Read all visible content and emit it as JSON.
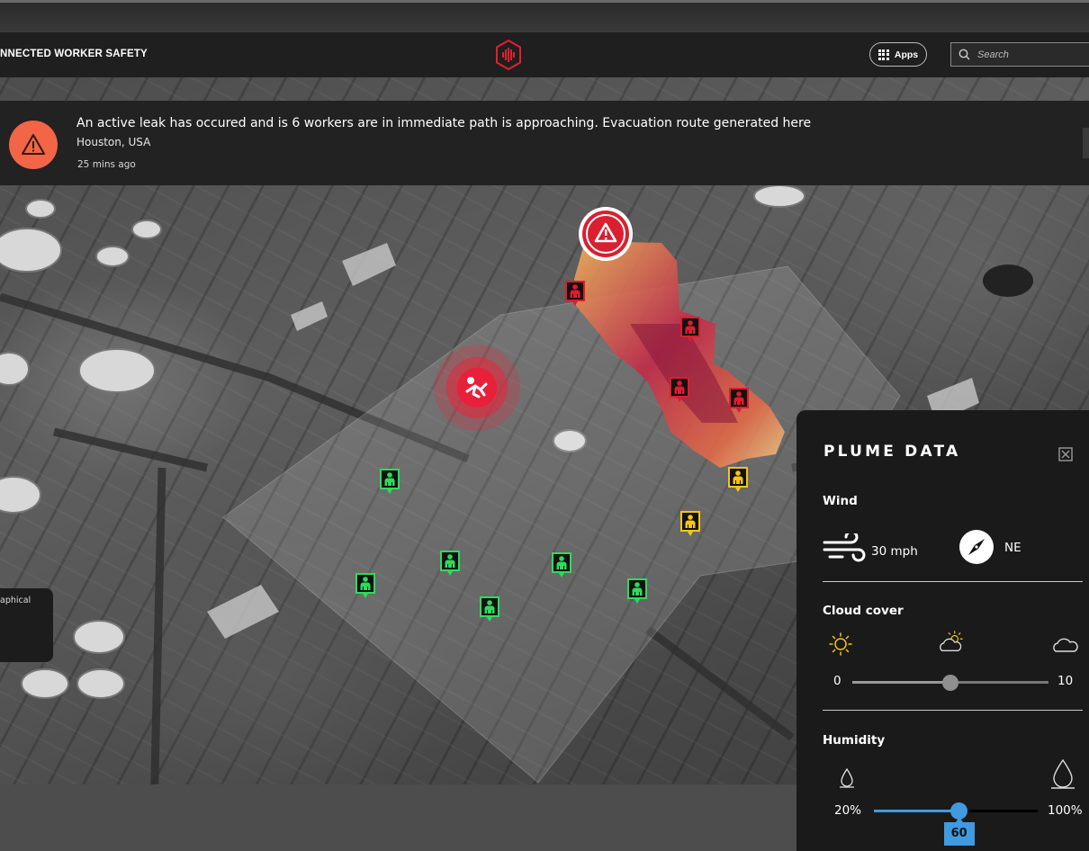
{
  "header": {
    "app_title": "NNECTED WORKER SAFETY",
    "apps_label": "Apps",
    "search_placeholder": "Search"
  },
  "alert": {
    "message": "An active leak has occured and is 6 workers are in immediate path is approaching. Evacuation route generated here",
    "location": "Houston, USA",
    "time": "25 mins ago",
    "color": "#f26546"
  },
  "left_card": {
    "text": "aphical"
  },
  "map": {
    "worker_status_colors": {
      "at_risk": "#e01b2f",
      "warning": "#f5c518",
      "safe": "#2ddc5a"
    },
    "workers": [
      {
        "status": "at_risk",
        "icon": "worker-icon"
      },
      {
        "status": "at_risk",
        "icon": "worker-icon"
      },
      {
        "status": "at_risk",
        "icon": "worker-icon"
      },
      {
        "status": "at_risk",
        "icon": "worker-icon"
      },
      {
        "status": "warning",
        "icon": "worker-icon"
      },
      {
        "status": "warning",
        "icon": "worker-icon"
      },
      {
        "status": "safe",
        "icon": "worker-icon"
      },
      {
        "status": "safe",
        "icon": "worker-icon"
      },
      {
        "status": "safe",
        "icon": "worker-icon"
      },
      {
        "status": "safe",
        "icon": "worker-icon"
      },
      {
        "status": "safe",
        "icon": "worker-icon"
      },
      {
        "status": "safe",
        "icon": "worker-icon"
      }
    ],
    "leak_marker_icon": "warning-triangle-icon",
    "evacuation_marker_icon": "running-person-icon"
  },
  "plume_panel": {
    "title": "PLUME DATA",
    "wind": {
      "label": "Wind",
      "speed": "30 mph",
      "direction": "NE"
    },
    "cloud_cover": {
      "label": "Cloud cover",
      "min": "0",
      "max": "10",
      "value_fraction": 0.5,
      "icons": [
        "sun-icon",
        "partly-cloudy-icon",
        "cloud-icon"
      ]
    },
    "humidity": {
      "label": "Humidity",
      "min": "20%",
      "max": "100%",
      "value": "60",
      "value_fraction": 0.52,
      "icons": [
        "small-droplet-icon",
        "large-droplet-icon"
      ],
      "accent": "#3f9be0"
    }
  }
}
